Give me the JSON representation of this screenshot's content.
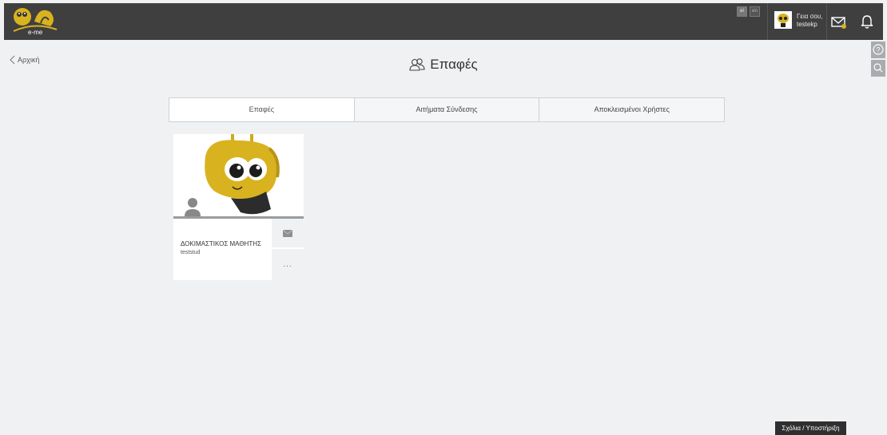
{
  "header": {
    "logo_text": "e-me",
    "languages": [
      "el",
      "en"
    ],
    "greeting_line1": "Γεια σου,",
    "greeting_line2": "testekp"
  },
  "nav": {
    "back_label": "Αρχική"
  },
  "page": {
    "title": "Επαφές"
  },
  "tabs": [
    {
      "label": "Επαφές",
      "active": true
    },
    {
      "label": "Αιτήματα Σύνδεσης",
      "active": false
    },
    {
      "label": "Αποκλεισμένοι Χρήστες",
      "active": false
    }
  ],
  "contacts": [
    {
      "name": "ΔΟΚΙΜΑΣΤΙΚΟΣ ΜΑΘΗΤΗΣ",
      "username": "teststud",
      "more_label": "..."
    }
  ],
  "footer": {
    "feedback_label": "Σχόλια / Υποστήριξη"
  },
  "colors": {
    "topbar": "#3f3f3f",
    "accent_yellow": "#d9b21f",
    "background": "#f0f1f3"
  }
}
